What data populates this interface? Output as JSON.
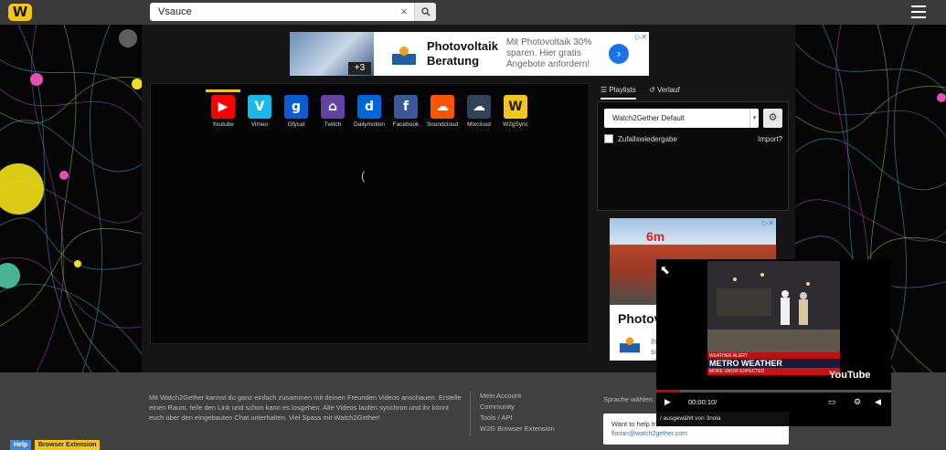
{
  "header": {
    "logo_text": "W",
    "search": {
      "value": "Vsauce",
      "clear_symbol": "×"
    }
  },
  "ad_top": {
    "plus_count": "+3",
    "headline": "Photovoltaik Beratung",
    "text": "Mit Photovoltaik 30% sparen. Hier gratis Angebote anfordern!",
    "go_symbol": "›"
  },
  "providers": [
    {
      "name": "Youtube",
      "color": "#ff0000",
      "glyph": "▶"
    },
    {
      "name": "Vimeo",
      "color": "#1ab7ea",
      "glyph": "V"
    },
    {
      "name": "Gfycat",
      "color": "#0a5bd4",
      "glyph": "g"
    },
    {
      "name": "Twitch",
      "color": "#6441a5",
      "glyph": "⌂"
    },
    {
      "name": "Dailymotion",
      "color": "#0066dc",
      "glyph": "d"
    },
    {
      "name": "Facebook",
      "color": "#3b5998",
      "glyph": "f"
    },
    {
      "name": "Soundcloud",
      "color": "#ff5500",
      "glyph": "☁"
    },
    {
      "name": "Mixcloud",
      "color": "#314359",
      "glyph": "☁"
    },
    {
      "name": "W2gSync",
      "color": "#f5c518",
      "glyph": "W"
    }
  ],
  "player": {
    "spinner": "("
  },
  "playlist": {
    "tabs": [
      {
        "label": "Playlists"
      },
      {
        "label": "Verlauf"
      }
    ],
    "selected": "Watch2Gether Default",
    "shuffle_label": "Zufallswiedergabe",
    "import_label": "Import?"
  },
  "ad_side": {
    "big_text": "6m",
    "headline": "Photov",
    "text": "Ihr\nsic\nab"
  },
  "footer": {
    "description": "Mit Watch2Gether kannst du ganz einfach zusammen mit deinen Freunden Videos anschauen. Erstelle einen Raum, teile den Link und schon kann es losgehen. Alle Videos laufen synchron und ihr könnt euch über den eingebauten Chat unterhalten. Viel Spass mit Watch2Gether!",
    "links": [
      {
        "label": "Mein Account"
      },
      {
        "label": "Community"
      },
      {
        "label": "Tools / API"
      },
      {
        "label": "W2G Browser Extension"
      }
    ],
    "language_label": "Sprache wählen:",
    "contact": {
      "text": "Want to help tra",
      "email": "florian@watch2gether.com"
    }
  },
  "badges": {
    "help": "Help",
    "extension": "Browser Extension"
  },
  "mini_player": {
    "alert": "WEATHER ALERT",
    "headline": "METRO WEATHER",
    "ticker": "MORE SNOW EXPECTED",
    "subticker": "SUME ON FRIDAY FEBRUARY 10TH",
    "clock": "6:14",
    "brand": "YouTube",
    "time": "00:00:10/",
    "progress_pct": 10,
    "title": "/ ausgewählt von 3nola"
  },
  "colors": {
    "accent": "#f5c518",
    "topbar": "#3a3a3a",
    "footer": "#404040"
  }
}
